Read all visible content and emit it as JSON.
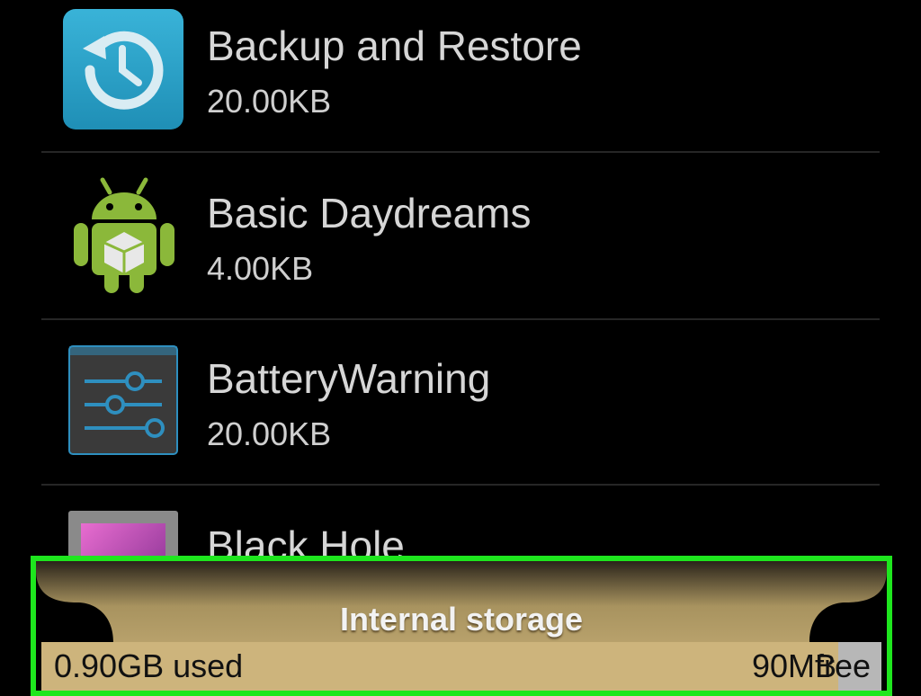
{
  "apps": [
    {
      "name": "Backup and Restore",
      "size": "20.00KB",
      "icon": "backup-restore-icon"
    },
    {
      "name": "Basic Daydreams",
      "size": "4.00KB",
      "icon": "android-robot-icon"
    },
    {
      "name": "BatteryWarning",
      "size": "20.00KB",
      "icon": "settings-sliders-icon"
    },
    {
      "name": "Black Hole",
      "size": "",
      "icon": "black-hole-wallpaper-icon"
    }
  ],
  "storage": {
    "title": "Internal storage",
    "used_label": "0.90GB used",
    "free_amount": "90MB",
    "free_label": "free"
  },
  "colors": {
    "highlight_border": "#1ee61e",
    "storage_panel": "#cdb47c",
    "free_segment": "#b7b7b7"
  }
}
